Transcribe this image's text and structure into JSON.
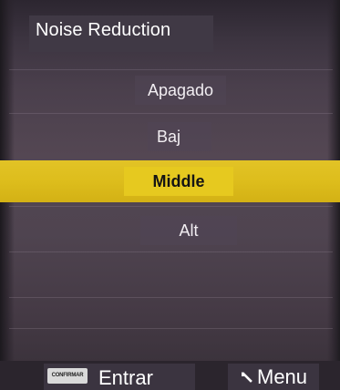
{
  "title": "Noise Reduction",
  "options": [
    {
      "label": "Apagado",
      "selected": false
    },
    {
      "label": "Baj",
      "selected": false
    },
    {
      "label": "Middle",
      "selected": true
    },
    {
      "label": "Alt",
      "selected": false
    }
  ],
  "footer": {
    "confirm_badge": "CONFIRMAR",
    "enter_label": "Entrar",
    "menu_icon": "return-arrow-icon",
    "menu_label": "Menu"
  },
  "colors": {
    "highlight": "#ddbd1c",
    "background": "#4f4450",
    "text": "#ffffff",
    "selected_text": "#141414"
  }
}
